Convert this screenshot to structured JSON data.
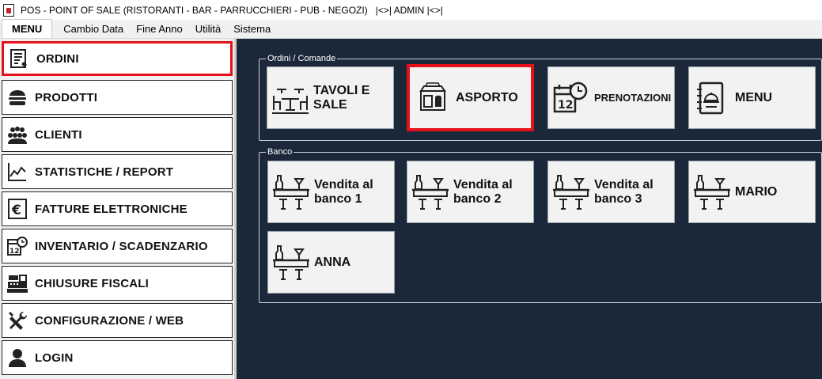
{
  "window": {
    "title": "POS - POINT OF SALE (RISTORANTI - BAR - PARRUCCHIERI - PUB - NEGOZI)   |<>| ADMIN |<>|"
  },
  "menubar": {
    "tabs": [
      {
        "label": "MENU",
        "active": true
      },
      {
        "label": "Cambio Data"
      },
      {
        "label": "Fine Anno"
      },
      {
        "label": "Utilità"
      },
      {
        "label": "Sistema"
      }
    ]
  },
  "sidebar": {
    "items": [
      {
        "label": "ORDINI",
        "icon": "order-list-icon",
        "selected": true
      },
      {
        "label": "PRODOTTI",
        "icon": "burger-icon"
      },
      {
        "label": "CLIENTI",
        "icon": "people-group-icon"
      },
      {
        "label": "STATISTICHE / REPORT",
        "icon": "line-chart-icon"
      },
      {
        "label": "FATTURE ELETTRONICHE",
        "icon": "euro-invoice-icon"
      },
      {
        "label": "INVENTARIO / SCADENZARIO",
        "icon": "calendar-clock-icon"
      },
      {
        "label": "CHIUSURE FISCALI",
        "icon": "cash-register-icon"
      },
      {
        "label": "CONFIGURAZIONE / WEB",
        "icon": "tools-icon"
      },
      {
        "label": "LOGIN",
        "icon": "user-icon"
      }
    ]
  },
  "ordini_group": {
    "legend": "Ordini / Comande",
    "tiles": [
      {
        "label_line1": "TAVOLI E",
        "label_line2": "SALE",
        "icon": "tables-icon"
      },
      {
        "label_line1": "ASPORTO",
        "label_line2": "",
        "icon": "takeaway-icon",
        "selected": true
      },
      {
        "label_line1": "PRENOTAZIONI",
        "label_line2": "",
        "icon": "calendar-clock-icon"
      },
      {
        "label_line1": "MENU",
        "label_line2": "",
        "icon": "menu-book-icon"
      }
    ]
  },
  "banco_group": {
    "legend": "Banco",
    "tiles": [
      {
        "label_line1": "Vendita al",
        "label_line2": "banco 1",
        "icon": "bar-counter-icon"
      },
      {
        "label_line1": "Vendita al",
        "label_line2": "banco 2",
        "icon": "bar-counter-icon"
      },
      {
        "label_line1": "Vendita al",
        "label_line2": "banco 3",
        "icon": "bar-counter-icon"
      },
      {
        "label_line1": "MARIO",
        "label_line2": "",
        "icon": "bar-counter-icon"
      },
      {
        "label_line1": "ANNA",
        "label_line2": "",
        "icon": "bar-counter-icon"
      }
    ]
  },
  "colors": {
    "accent_selection": "#e3121a",
    "main_background": "#1b2839",
    "tile_background": "#f2f2f2"
  }
}
